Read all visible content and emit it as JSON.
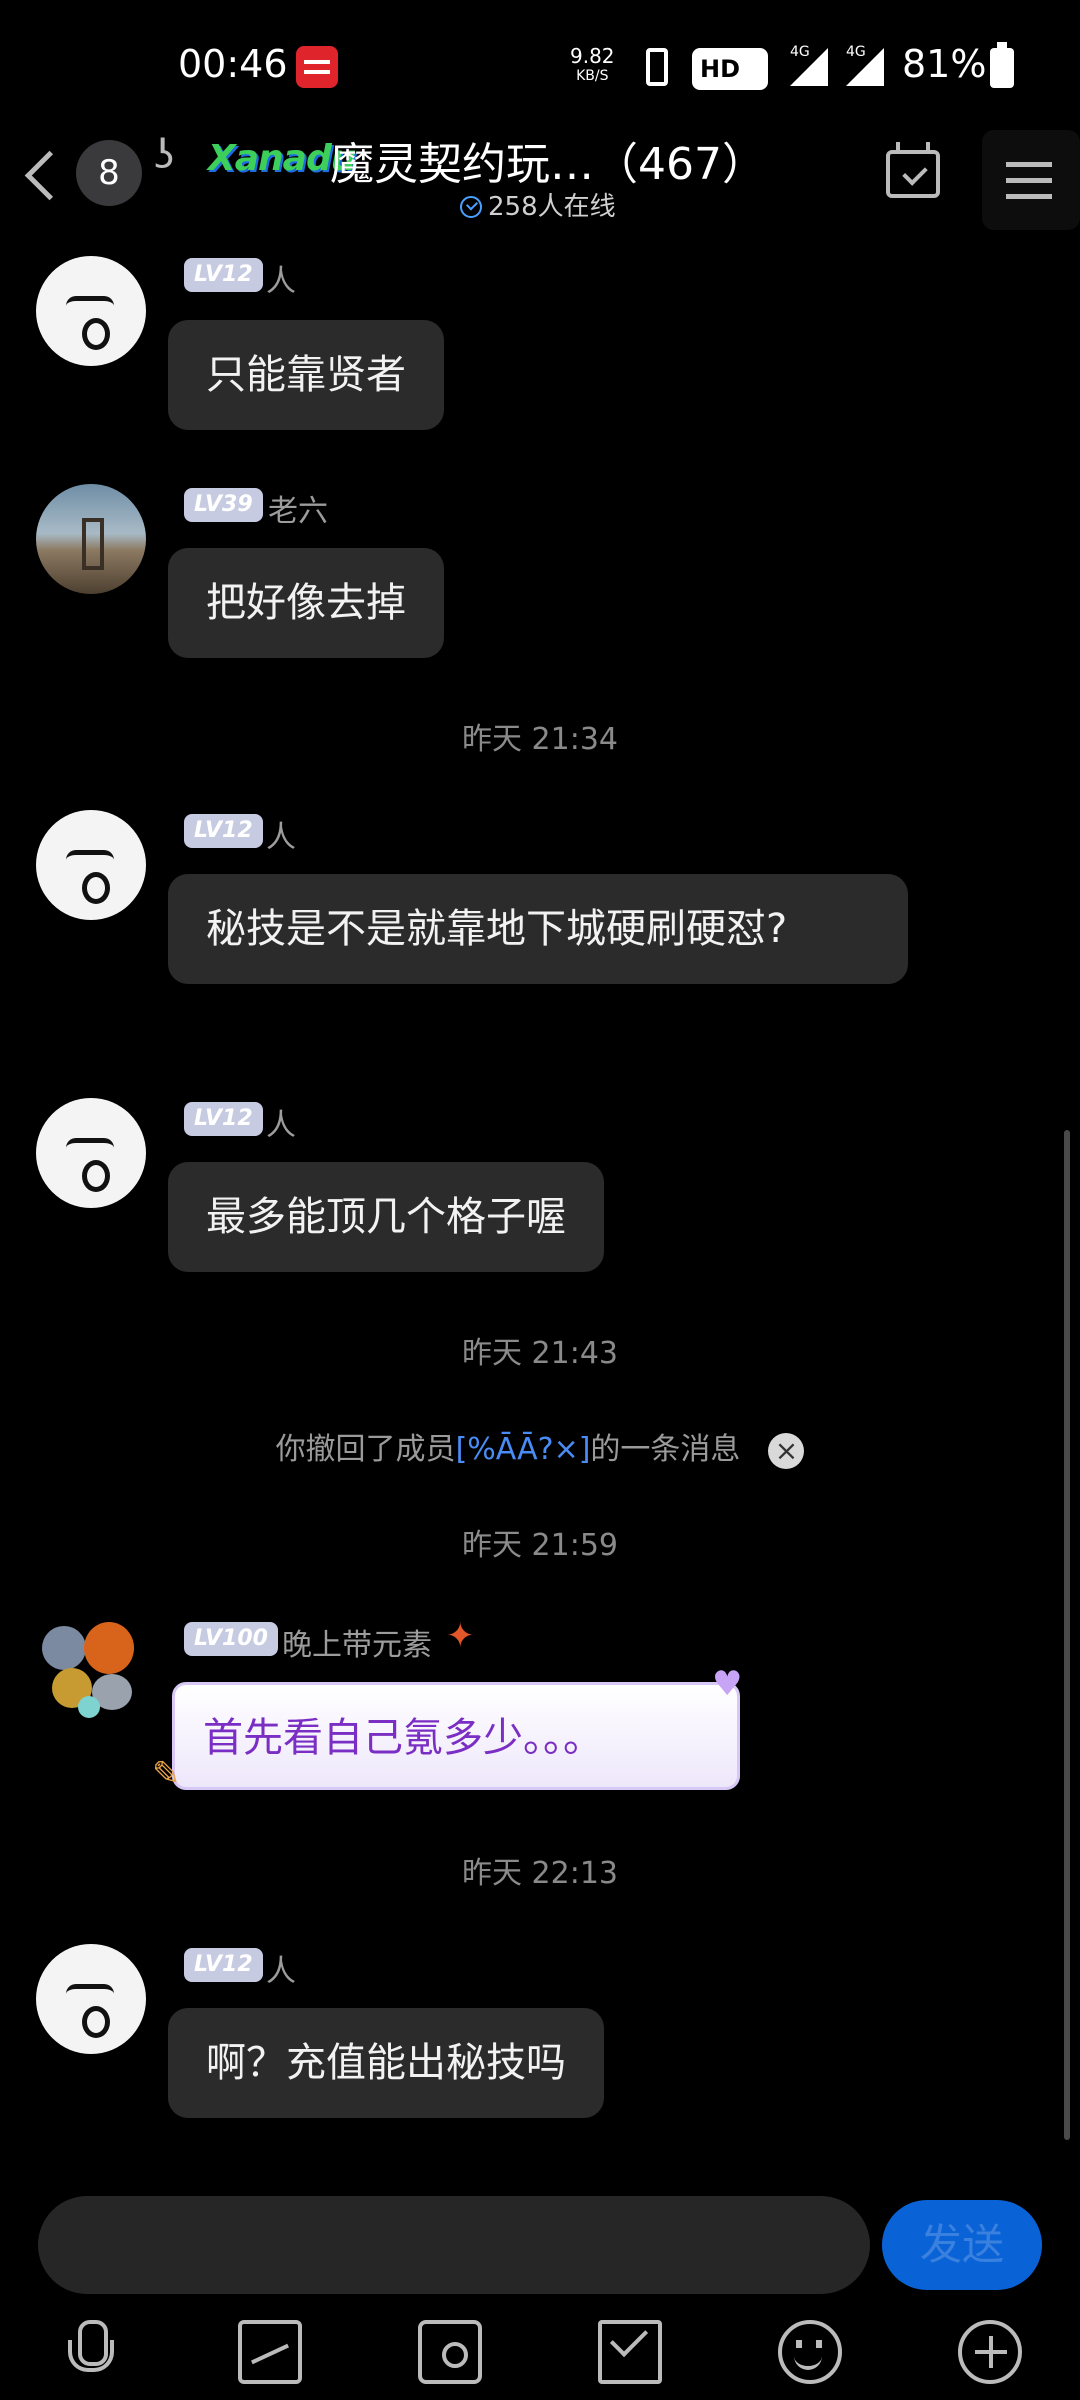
{
  "status_bar": {
    "time": "00:46",
    "net_speed": "9.82",
    "net_unit": "KB/S",
    "hd_label": "HD",
    "network_1": "4G",
    "network_2": "4G",
    "battery": "81%"
  },
  "header": {
    "unread_count": "8",
    "logo_text": "Xanadu",
    "group_title": "魔灵契约玩…（467）",
    "online_text": "258人在线"
  },
  "messages": [
    {
      "level": "LV12",
      "nickname": "人",
      "text": "只能靠贤者"
    },
    {
      "level": "LV39",
      "nickname": "老六",
      "text": "把好像去掉"
    },
    {
      "level": "LV12",
      "nickname": "人",
      "text": "秘技是不是就靠地下城硬刷硬怼?"
    },
    {
      "level": "LV12",
      "nickname": "人",
      "text": "最多能顶几个格子喔"
    },
    {
      "level": "LV100",
      "nickname": "晚上带元素",
      "text": "首先看自己氪多少。。。"
    },
    {
      "level": "LV12",
      "nickname": "人",
      "text": "啊？充值能出秘技吗"
    }
  ],
  "timestamps": [
    "昨天 21:34",
    "昨天 21:43",
    "昨天 21:59",
    "昨天 22:13"
  ],
  "recall_notice": {
    "prefix": "你撤回了成员",
    "member": "[%ĀĀ?×]",
    "suffix": "的一条消息"
  },
  "input": {
    "placeholder": "",
    "send_label": "发送"
  },
  "colors": {
    "background": "#000000",
    "bubble": "#2b2b2b",
    "accent": "#0a63d6",
    "level_badge": "#c7cbe2"
  }
}
